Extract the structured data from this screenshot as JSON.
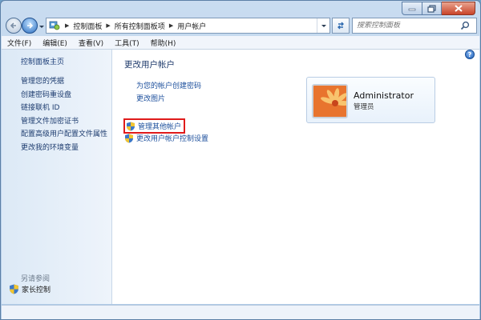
{
  "window": {
    "minimize": "minimize",
    "maximize": "maximize",
    "close": "close"
  },
  "address": {
    "breadcrumbs": [
      "控制面板",
      "所有控制面板项",
      "用户帐户"
    ]
  },
  "search": {
    "placeholder": "搜索控制面板"
  },
  "menu": [
    "文件(F)",
    "编辑(E)",
    "查看(V)",
    "工具(T)",
    "帮助(H)"
  ],
  "sidebar": {
    "home": "控制面板主页",
    "links": [
      "管理您的凭据",
      "创建密码重设盘",
      "链接联机 ID",
      "管理文件加密证书",
      "配置高级用户配置文件属性",
      "更改我的环境变量"
    ],
    "see_also": "另请参阅",
    "parental": "家长控制"
  },
  "main": {
    "title": "更改用户帐户",
    "tasks": [
      "为您的帐户创建密码",
      "更改图片"
    ],
    "shield_tasks": [
      "管理其他帐户",
      "更改用户帐户控制设置"
    ],
    "help": "?"
  },
  "user": {
    "name": "Administrator",
    "role": "管理员"
  },
  "colors": {
    "link": "#1c4f9c",
    "highlight_border": "#e01b1b",
    "sidebar_bg": "#dce9f6"
  }
}
